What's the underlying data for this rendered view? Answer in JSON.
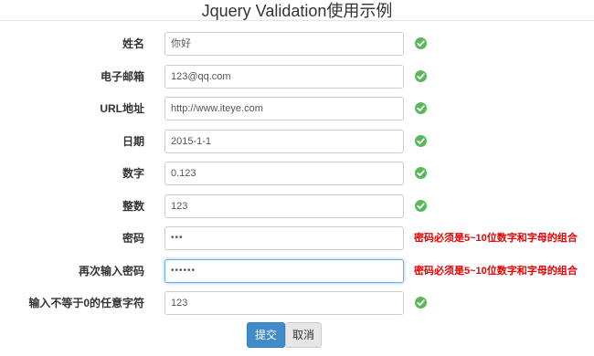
{
  "page": {
    "title": "Jquery Validation使用示例"
  },
  "form": {
    "fields": [
      {
        "label": "姓名",
        "value": "你好",
        "status": "valid"
      },
      {
        "label": "电子邮箱",
        "value": "123@qq.com",
        "status": "valid"
      },
      {
        "label": "URL地址",
        "value": "http://www.iteye.com",
        "status": "valid"
      },
      {
        "label": "日期",
        "value": "2015-1-1",
        "status": "valid"
      },
      {
        "label": "数字",
        "value": "0.123",
        "status": "valid"
      },
      {
        "label": "整数",
        "value": "123",
        "status": "valid"
      },
      {
        "label": "密码",
        "value": "•••",
        "status": "error",
        "error": "密码必须是5~10位数字和字母的组合"
      },
      {
        "label": "再次输入密码",
        "value": "••••••",
        "status": "error",
        "error": "密码必须是5~10位数字和字母的组合"
      },
      {
        "label": "输入不等于0的任意字符",
        "value": "123",
        "status": "valid"
      }
    ],
    "submit_label": "提交",
    "cancel_label": "取消"
  },
  "colors": {
    "valid": "#5cb85c",
    "error": "#e60000",
    "primary": "#428bca"
  },
  "icons": {
    "valid": "check-circle-icon"
  }
}
